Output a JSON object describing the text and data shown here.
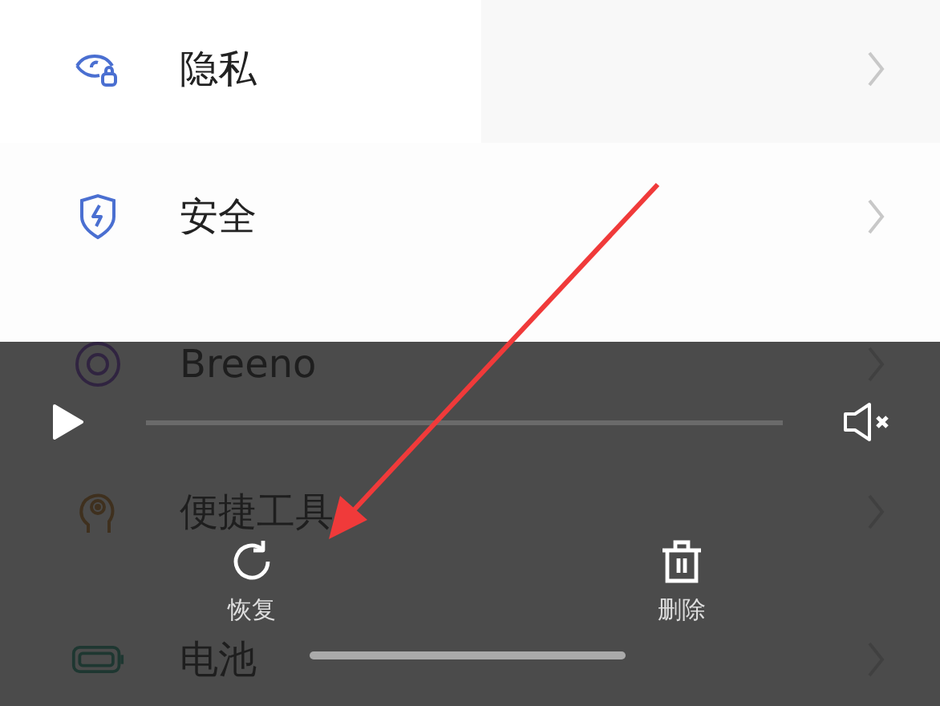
{
  "settings": [
    {
      "label": "隐私"
    },
    {
      "label": "安全"
    },
    {
      "label": "Breeno"
    },
    {
      "label": "便捷工具"
    },
    {
      "label": "电池"
    }
  ],
  "player": {
    "playing": false,
    "muted": true,
    "actions": [
      {
        "kind": "restore",
        "label": "恢复"
      },
      {
        "kind": "delete",
        "label": "删除"
      }
    ]
  }
}
